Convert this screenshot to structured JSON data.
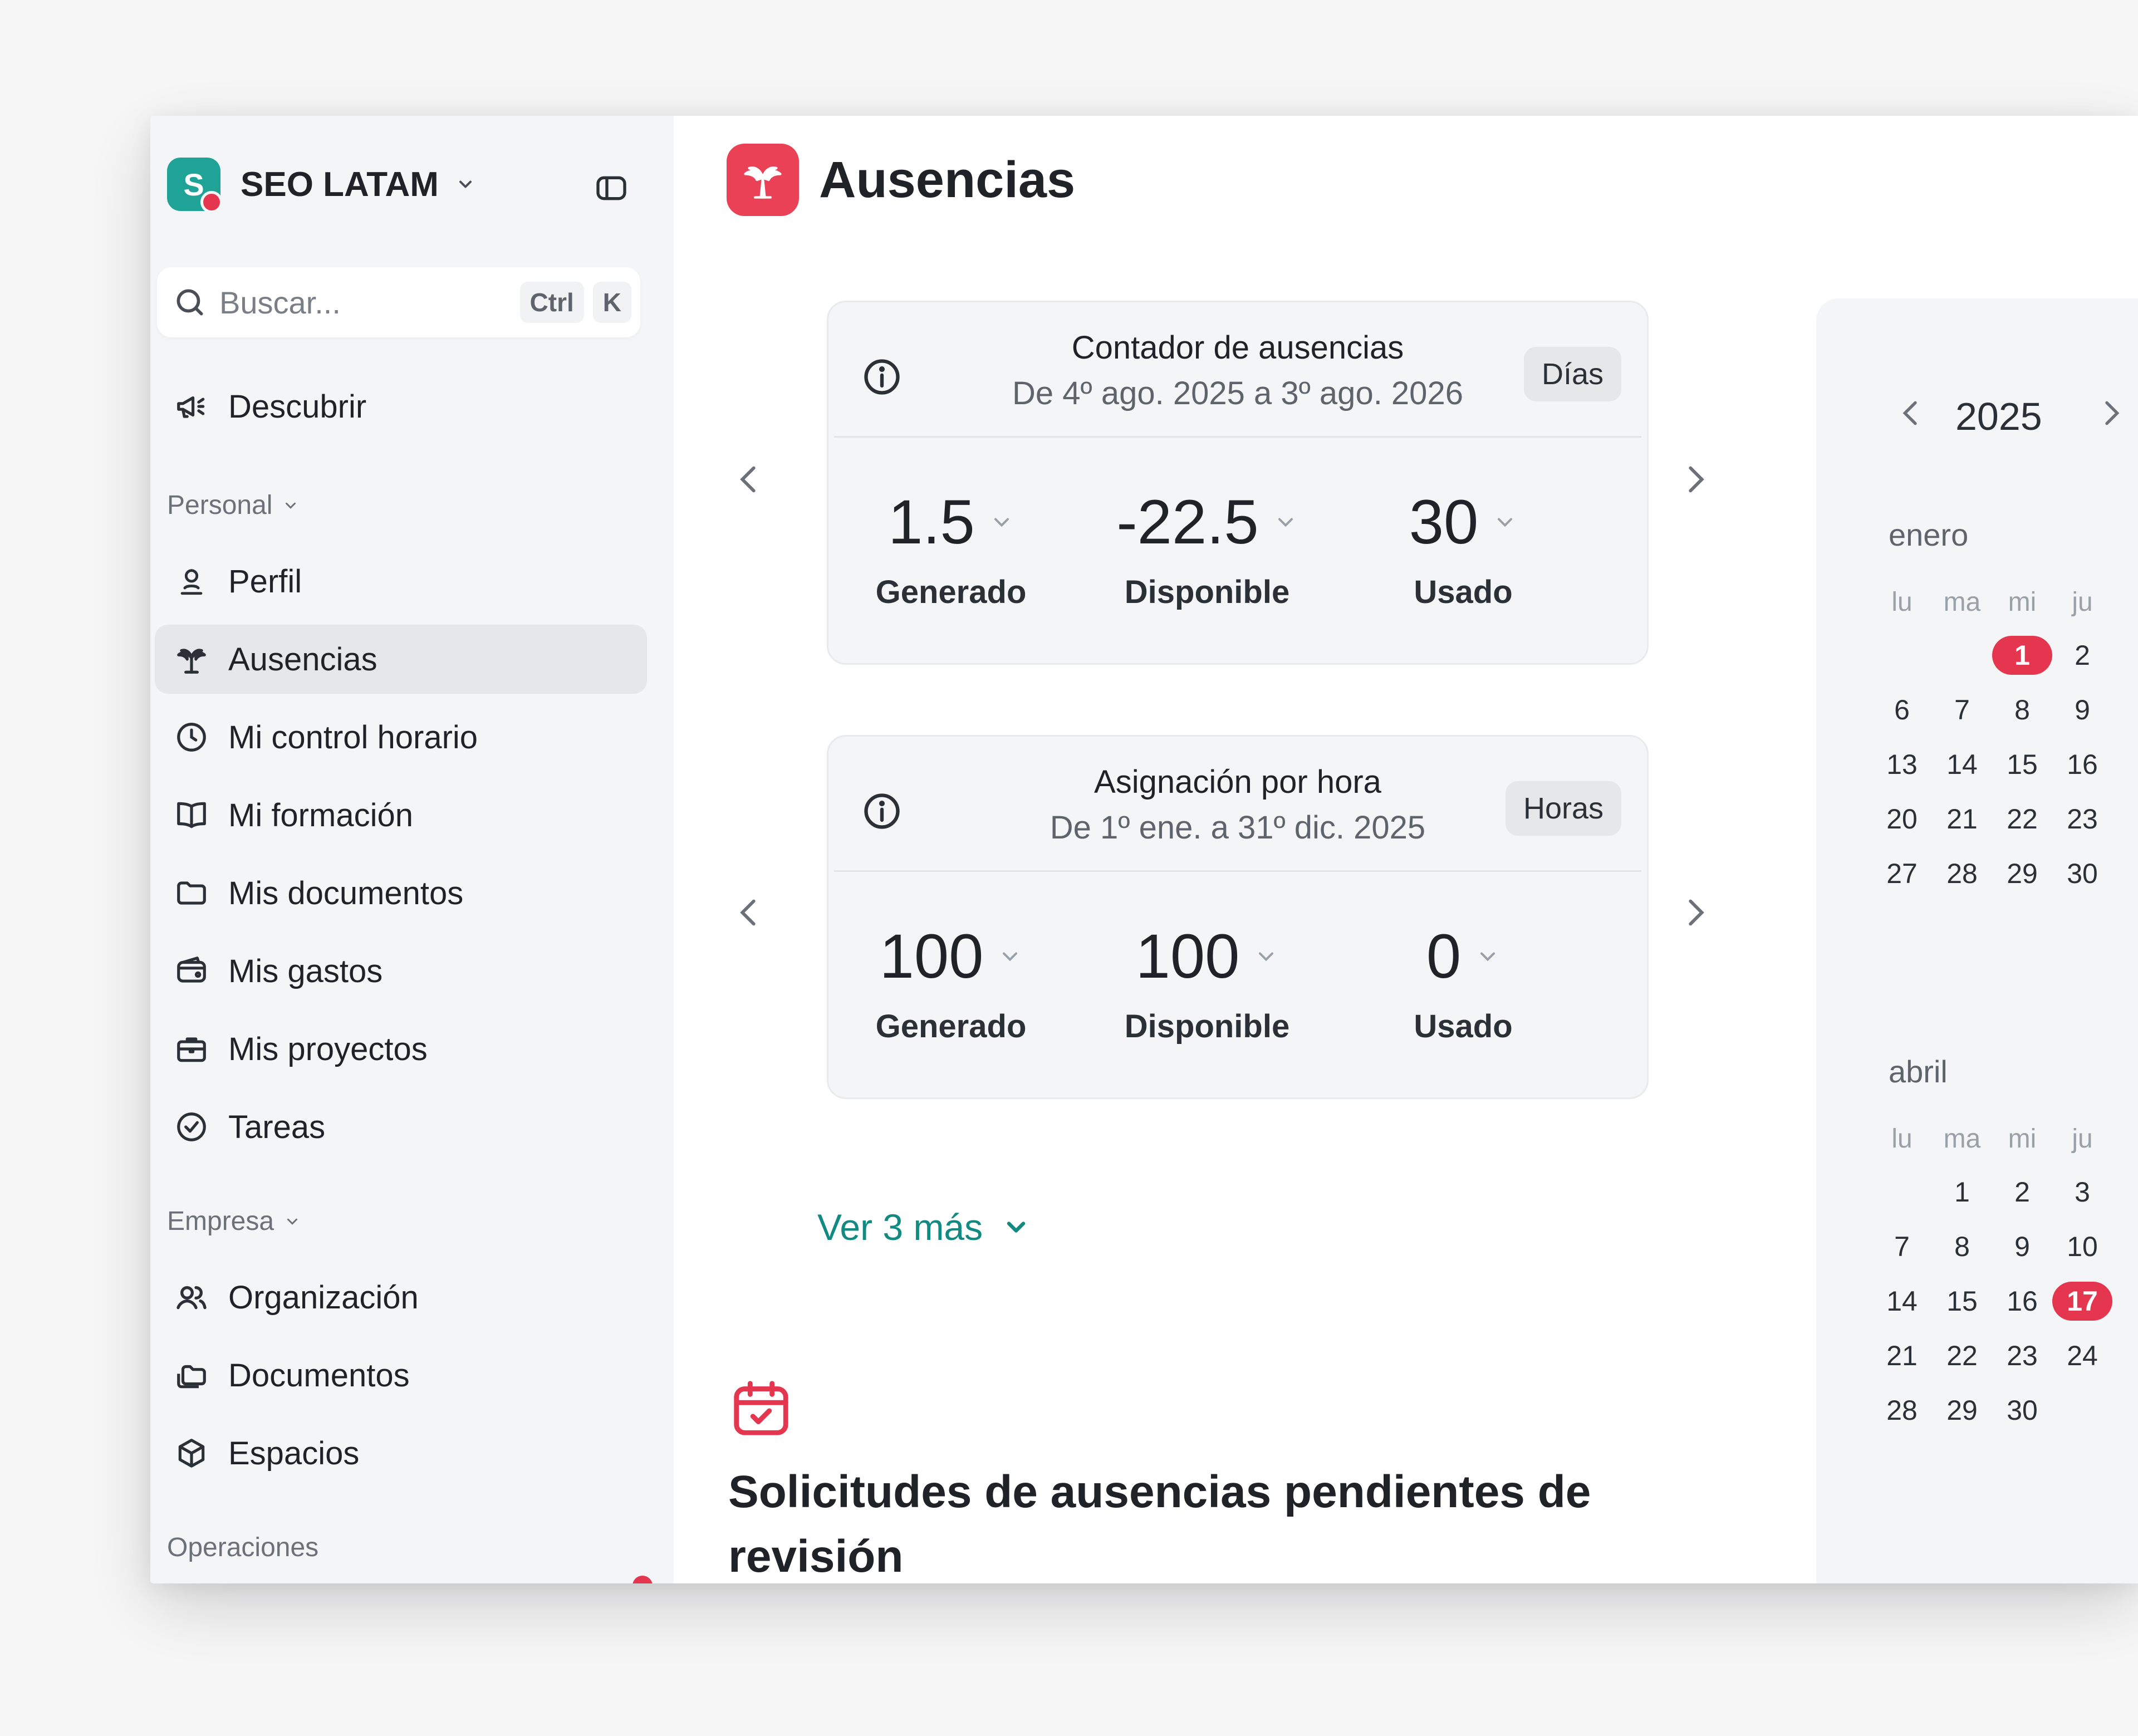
{
  "workspace": {
    "logo_letter": "S",
    "name": "SEO LATAM"
  },
  "search": {
    "placeholder": "Buscar...",
    "shortcut_ctrl": "Ctrl",
    "shortcut_key": "K"
  },
  "sidebar": {
    "discover": "Descubrir",
    "personal_label": "Personal",
    "personal_items": [
      "Perfil",
      "Ausencias",
      "Mi control horario",
      "Mi formación",
      "Mis documentos",
      "Mis gastos",
      "Mis proyectos",
      "Tareas"
    ],
    "active_item": "Ausencias",
    "company_label": "Empresa",
    "company_items": [
      "Organización",
      "Documentos",
      "Espacios"
    ],
    "operations_label": "Operaciones"
  },
  "page": {
    "title": "Ausencias"
  },
  "cards": [
    {
      "title": "Contador de ausencias",
      "period": "De 4º ago. 2025 a 3º ago. 2026",
      "unit": "Días",
      "stats": [
        {
          "value": "1.5",
          "label": "Generado"
        },
        {
          "value": "-22.5",
          "label": "Disponible"
        },
        {
          "value": "30",
          "label": "Usado"
        }
      ]
    },
    {
      "title": "Asignación por hora",
      "period": "De 1º ene. a 31º dic. 2025",
      "unit": "Horas",
      "stats": [
        {
          "value": "100",
          "label": "Generado"
        },
        {
          "value": "100",
          "label": "Disponible"
        },
        {
          "value": "0",
          "label": "Usado"
        }
      ]
    }
  ],
  "more_link": "Ver 3 más",
  "pending": {
    "title": "Solicitudes de ausencias pendientes de revisión"
  },
  "calendar": {
    "year": "2025",
    "day_headers": [
      "lu",
      "ma",
      "mi",
      "ju"
    ],
    "months": [
      {
        "name": "enero",
        "weeks": [
          [
            "",
            "",
            "1",
            "2"
          ],
          [
            "6",
            "7",
            "8",
            "9"
          ],
          [
            "13",
            "14",
            "15",
            "16"
          ],
          [
            "20",
            "21",
            "22",
            "23"
          ],
          [
            "27",
            "28",
            "29",
            "30"
          ]
        ],
        "highlight": "1"
      },
      {
        "name": "abril",
        "weeks": [
          [
            "",
            "1",
            "2",
            "3"
          ],
          [
            "7",
            "8",
            "9",
            "10"
          ],
          [
            "14",
            "15",
            "16",
            "17"
          ],
          [
            "21",
            "22",
            "23",
            "24"
          ],
          [
            "28",
            "29",
            "30",
            ""
          ]
        ],
        "highlight": "17"
      }
    ]
  },
  "colors": {
    "brand_teal": "#1fa397",
    "accent_red": "#e5364f",
    "link_teal": "#128a82",
    "page_icon": "#ea4156"
  },
  "icons": {
    "discover": "megaphone-icon",
    "profile": "user-icon",
    "absences": "palm-tree-icon",
    "time": "clock-icon",
    "training": "book-icon",
    "documents": "folder-icon",
    "expenses": "wallet-icon",
    "projects": "briefcase-icon",
    "tasks": "check-circle-icon",
    "organization": "users-icon",
    "company_documents": "folders-icon",
    "spaces": "cube-icon"
  }
}
